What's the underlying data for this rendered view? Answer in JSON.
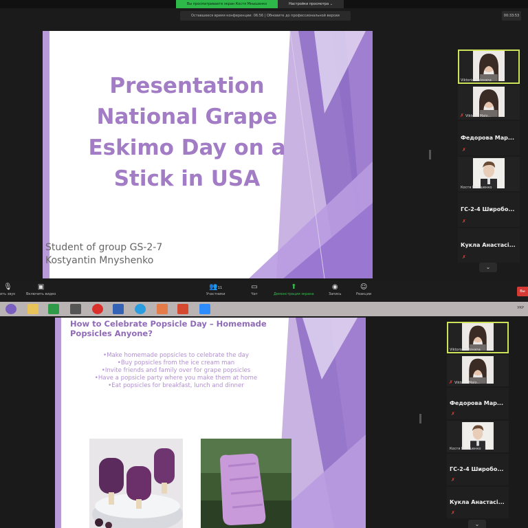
{
  "screen1": {
    "share_banner": "Вы просматриваете экран Костя Мнышенко",
    "view_options": "Настройки просмотра ⌄",
    "conference_notice": "Оставшееся время конференции: 06:56 | Обновите до профессиональной версии",
    "timer": "00:33:53",
    "slide": {
      "title_lines": [
        "Presentation",
        "National Grape",
        "Eskimo Day on a",
        "Stick in USA"
      ],
      "subtitle_lines": [
        "Student of group GS-2-7",
        "Kostyantin Mnyshenko"
      ]
    },
    "participants": [
      {
        "name": "Viktoria Malovana",
        "type": "video",
        "active": true
      },
      {
        "name": "Viktoria Malo...",
        "type": "video",
        "muted": true
      },
      {
        "name": "Федорова Мар...",
        "type": "name",
        "muted": true
      },
      {
        "name": "Костя Мнышенко",
        "type": "video"
      },
      {
        "name": "ГС-2-4 Широбо...",
        "type": "name",
        "muted": true
      },
      {
        "name": "Кукла Анастасі...",
        "type": "name",
        "muted": true
      }
    ],
    "toolbar": {
      "audio_label": "ить звук",
      "video_label": "Включить видео",
      "participants_label": "Участники",
      "participants_count": "11",
      "chat_label": "Чат",
      "share_label": "Демонстрация экрана",
      "record_label": "Запись",
      "reactions_label": "Реакции",
      "end_label": "Вы"
    },
    "tray_text": "УКР"
  },
  "screen2": {
    "slide": {
      "title_lines": [
        "How to Celebrate Popsicle Day – Homemade",
        "Popsicles Anyone?"
      ],
      "bullets": [
        "•Make homemade popsicles to celebrate the day",
        "•Buy popsicles from the ice cream man",
        "•Invite friends and family over for grape popsicles",
        "•Have a popsicle party where you make them at home",
        "•Eat popsicles for breakfast, lunch and dinner"
      ]
    },
    "participants": [
      {
        "name": "Viktoria Malovana",
        "type": "video",
        "active": true
      },
      {
        "name": "Viktoria Malo...",
        "type": "video",
        "muted": true
      },
      {
        "name": "Федорова Мар...",
        "type": "name",
        "muted": true
      },
      {
        "name": "Костя Мнышенко",
        "type": "video"
      },
      {
        "name": "ГС-2-4 Широбо...",
        "type": "name",
        "muted": true
      },
      {
        "name": "Кукла Анастасі...",
        "type": "name",
        "muted": true
      }
    ]
  },
  "icons": {
    "chevron": "⌄",
    "mute": "✗"
  },
  "colors": {
    "title_purple": "#a27cc4",
    "accent_green": "#2fb84a",
    "active_border": "#cfe35a",
    "end_red": "#d63a35"
  }
}
